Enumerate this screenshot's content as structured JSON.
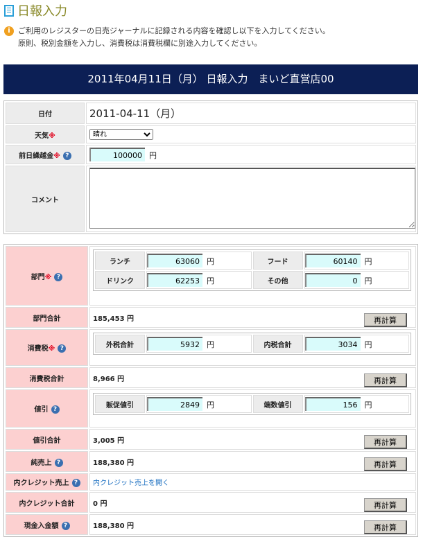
{
  "page": {
    "title": "日報入力",
    "notice": [
      "ご利用のレジスターの日売ジャーナルに記録される内容を確認し以下を入力してください。",
      "原則、税別金額を入力し、消費税は消費税欄に別途入力してください。"
    ],
    "banner": "2011年04月11日（月） 日報入力　まいど直営店00"
  },
  "basic": {
    "date_label": "日付",
    "date_value": "2011-04-11（月）",
    "weather_label": "天気",
    "weather_value": "晴れ",
    "carry_label": "前日繰越金",
    "carry_value": "100000",
    "comment_label": "コメント",
    "comment_value": "",
    "required_mark": "※",
    "yen": "円",
    "help": "?"
  },
  "dept": {
    "label": "部門",
    "items": [
      {
        "label": "ランチ",
        "value": "63060"
      },
      {
        "label": "フード",
        "value": "60140"
      },
      {
        "label": "ドリンク",
        "value": "62253"
      },
      {
        "label": "その他",
        "value": "0"
      }
    ],
    "total_label": "部門合計",
    "total": "185,453 円"
  },
  "tax": {
    "label": "消費税",
    "items": [
      {
        "label": "外税合計",
        "value": "5932"
      },
      {
        "label": "内税合計",
        "value": "3034"
      }
    ],
    "total_label": "消費税合計",
    "total": "8,966 円"
  },
  "discount": {
    "label": "値引",
    "items": [
      {
        "label": "販促値引",
        "value": "2849"
      },
      {
        "label": "端数値引",
        "value": "156"
      }
    ],
    "total_label": "値引合計",
    "total": "3,005 円"
  },
  "net": {
    "label": "純売上",
    "total": "188,380 円"
  },
  "credit": {
    "label": "内クレジット売上",
    "link": "内クレジット売上を開く",
    "total_label": "内クレジット合計",
    "total": "0 円"
  },
  "cash": {
    "label": "現金入金額",
    "total": "188,380 円"
  },
  "recalc_label": "再計算",
  "colors": {
    "banner": "#0c1f55",
    "label_pink": "#fcd0d0",
    "input_bg": "#d9fbfb",
    "title": "#8a8a2a"
  }
}
